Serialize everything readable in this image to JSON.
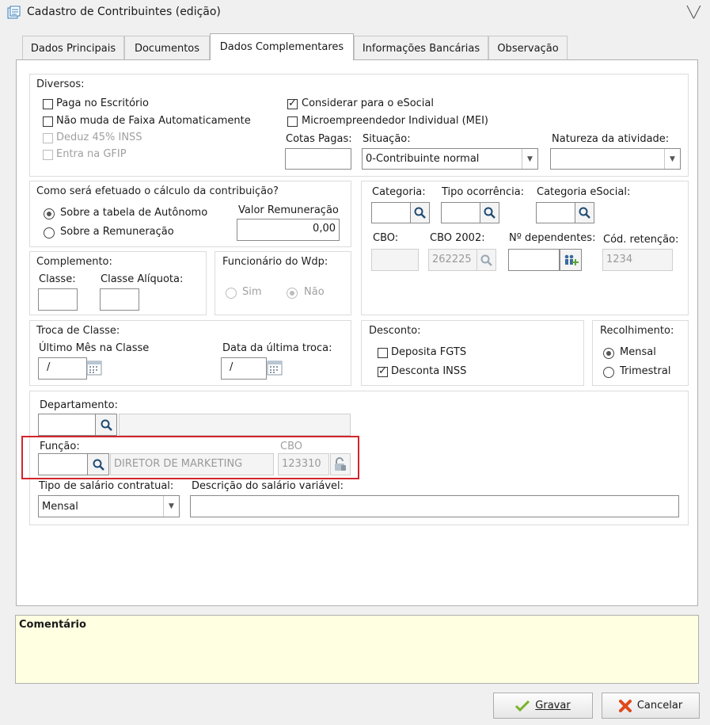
{
  "window": {
    "title": "Cadastro de Contribuintes (edição)"
  },
  "tabs": [
    "Dados Principais",
    "Documentos",
    "Dados Complementares",
    "Informações Bancárias",
    "Observação"
  ],
  "diversos": {
    "title": "Diversos:",
    "paga_escritorio": "Paga no Escritório",
    "nao_muda_faixa": "Não muda de Faixa Automaticamente",
    "deduz_inss": "Deduz 45% INSS",
    "entra_gfip": "Entra na GFIP",
    "considerar_esocial": "Considerar para o eSocial",
    "mei": "Microempreendedor Individual (MEI)",
    "cotas_label": "Cotas Pagas:",
    "cotas_value": "",
    "situacao_label": "Situação:",
    "situacao_value": "0-Contribuinte normal",
    "natureza_label": "Natureza da atividade:",
    "natureza_value": ""
  },
  "calculo": {
    "title": "Como será efetuado o cálculo da contribuição?",
    "opt1": "Sobre a tabela de Autônomo",
    "opt2": "Sobre a Remuneração",
    "valor_label": "Valor Remuneração",
    "valor_value": "0,00"
  },
  "categoria": {
    "categoria_label": "Categoria:",
    "tipo_label": "Tipo ocorrência:",
    "cat_esocial_label": "Categoria eSocial:",
    "cbo_label": "CBO:",
    "cbo2002_label": "CBO 2002:",
    "cbo2002_value": "262225",
    "dependentes_label": "Nº dependentes:",
    "retencao_label": "Cód. retenção:",
    "retencao_value": "1234"
  },
  "complemento": {
    "title": "Complemento:",
    "classe_label": "Classe:",
    "aliquota_label": "Classe Alíquota:"
  },
  "funcionario": {
    "title": "Funcionário do Wdp:",
    "sim": "Sim",
    "nao": "Não"
  },
  "troca": {
    "title": "Troca de Classe:",
    "ultimo_label": "Último Mês na Classe",
    "ultimo_value": "/",
    "data_label": "Data da última troca:",
    "data_value": "/"
  },
  "desconto": {
    "title": "Desconto:",
    "fgts": "Deposita FGTS",
    "inss": "Desconta INSS"
  },
  "recolhimento": {
    "title": "Recolhimento:",
    "mensal": "Mensal",
    "trimestral": "Trimestral"
  },
  "departamento": {
    "label": "Departamento:"
  },
  "funcao": {
    "label": "Função:",
    "desc_value": "DIRETOR DE MARKETING",
    "cbo_label": "CBO",
    "cbo_value": "123310"
  },
  "salario": {
    "tipo_label": "Tipo de salário contratual:",
    "tipo_value": "Mensal",
    "desc_label": "Descrição do salário variável:"
  },
  "comentario": {
    "title": "Comentário"
  },
  "buttons": {
    "gravar": "Gravar",
    "cancelar": "Cancelar"
  },
  "colors": {
    "highlight": "#d3262b",
    "comment_bg": "#ffffe1"
  }
}
